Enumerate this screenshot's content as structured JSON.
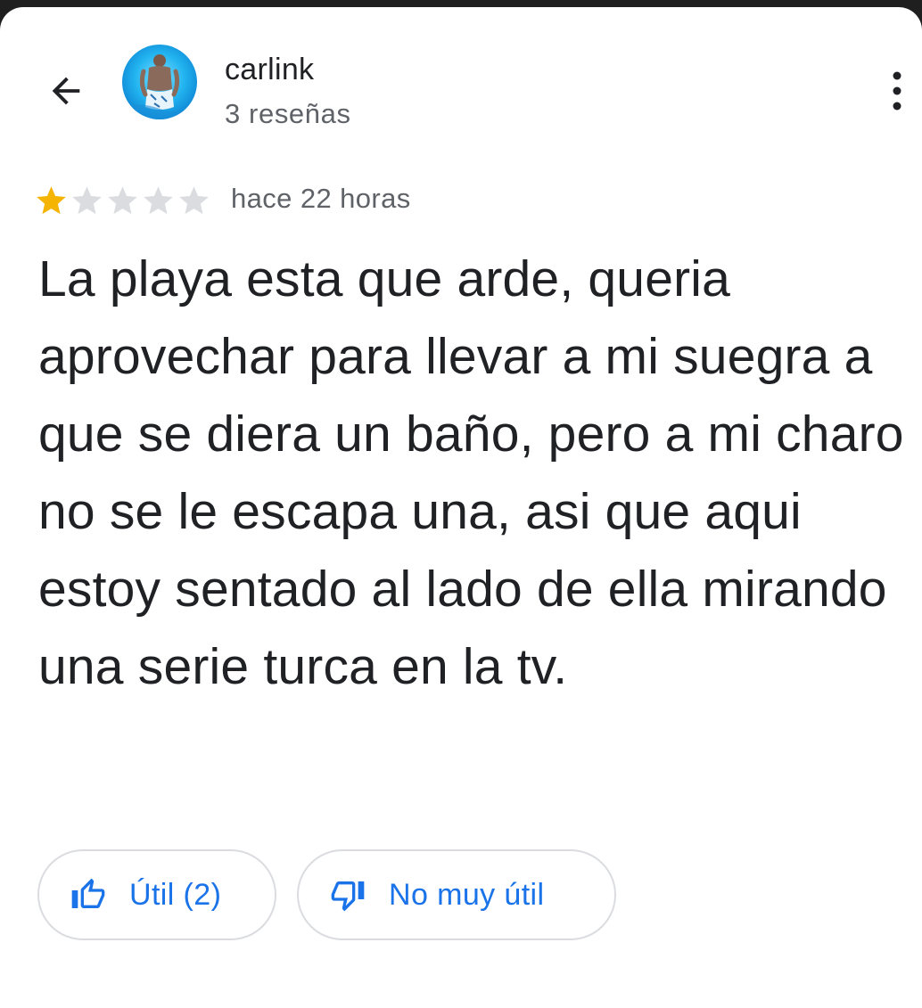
{
  "header": {
    "back_icon": "arrow-back-icon",
    "avatar_icon": "avatar-photo",
    "user_name": "carlink",
    "review_count": "3 reseñas",
    "more_icon": "more-vertical-icon"
  },
  "review": {
    "rating": 1,
    "max_rating": 5,
    "date": "hace 22 horas",
    "text": "La playa esta que arde, queria aprovechar para llevar a mi suegra a que se diera un baño, pero a mi charo no se le escapa una, asi que aqui estoy sentado al lado de ella mirando una serie turca en la tv."
  },
  "actions": {
    "helpful_icon": "thumb-up-icon",
    "helpful_label": "Útil (2)",
    "not_helpful_icon": "thumb-down-icon",
    "not_helpful_label": "No muy útil"
  },
  "colors": {
    "star_filled": "#f4b400",
    "star_empty": "#dadce0",
    "accent": "#1a73e8",
    "text_primary": "#202124",
    "text_secondary": "#5f6368"
  }
}
